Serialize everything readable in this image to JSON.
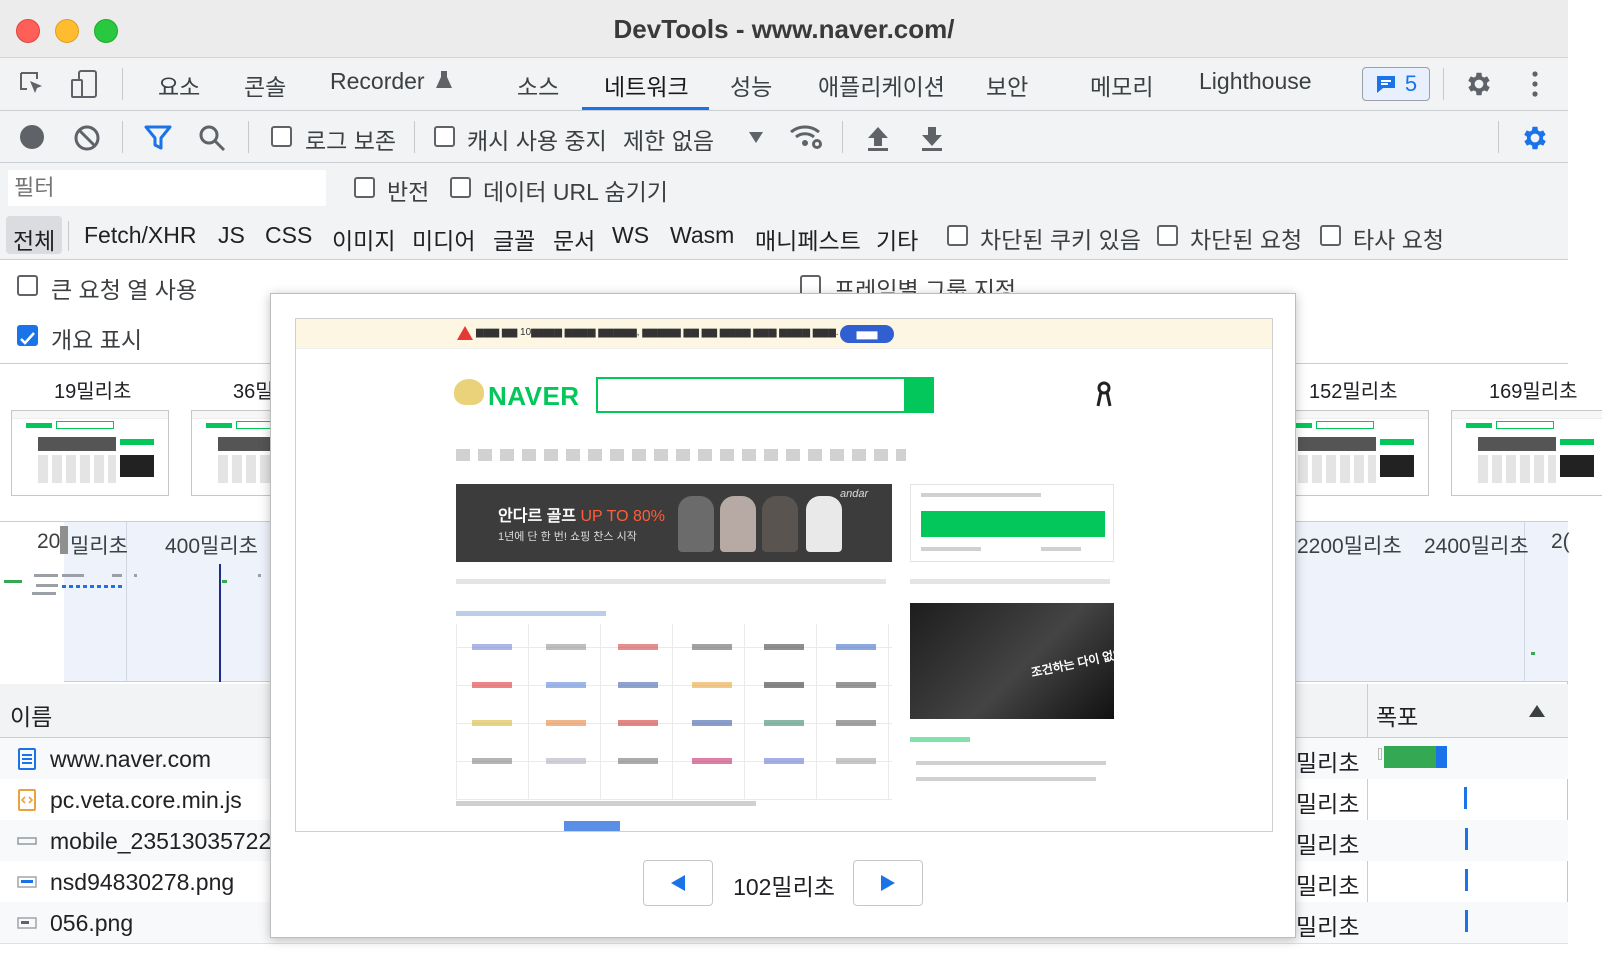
{
  "window": {
    "title": "DevTools - www.naver.com/"
  },
  "tabs": [
    {
      "label": "요소"
    },
    {
      "label": "콘솔"
    },
    {
      "label": "Recorder"
    },
    {
      "label": "소스"
    },
    {
      "label": "네트워크",
      "active": true
    },
    {
      "label": "성능"
    },
    {
      "label": "애플리케이션"
    },
    {
      "label": "보안"
    },
    {
      "label": "메모리"
    },
    {
      "label": "Lighthouse"
    }
  ],
  "issues_count": "5",
  "toolbar": {
    "preserve_log": "로그 보존",
    "disable_cache": "캐시 사용 중지",
    "throttle": "제한 없음"
  },
  "filter": {
    "placeholder": "필터",
    "invert": "반전",
    "hide_data_urls": "데이터 URL 숨기기"
  },
  "types": [
    "전체",
    "Fetch/XHR",
    "JS",
    "CSS",
    "이미지",
    "미디어",
    "글꼴",
    "문서",
    "WS",
    "Wasm",
    "매니페스트",
    "기타"
  ],
  "type_filters": {
    "blocked_cookies": "차단된 쿠키 있음",
    "blocked_requests": "차단된 요청",
    "third_party": "타사 요청"
  },
  "settings": {
    "big_rows": "큰 요청 열 사용",
    "group_by_frame": "프레임별 그룹 지정",
    "show_overview": "개요 표시"
  },
  "filmstrip": [
    {
      "label": "19밀리초"
    },
    {
      "label": "36밀"
    },
    {
      "label": "152밀리초"
    },
    {
      "label": "169밀리초"
    }
  ],
  "overview_ticks": [
    "20",
    "밀리초",
    "400밀리초",
    "2200밀리초",
    "2400밀리초",
    "2("
  ],
  "table": {
    "name_header": "이름",
    "waterfall_header": "폭포",
    "rows": [
      {
        "name": "www.naver.com",
        "time": "밀리초",
        "icon": "document-icon"
      },
      {
        "name": "pc.veta.core.min.js",
        "time": "밀리초",
        "icon": "script-icon"
      },
      {
        "name": "mobile_23513035722",
        "time": "밀리초",
        "icon": "file-icon"
      },
      {
        "name": "nsd94830278.png",
        "time": "밀리초",
        "icon": "image-icon"
      },
      {
        "name": "056.png",
        "time": "밀리초",
        "icon": "image-icon"
      }
    ]
  },
  "popup": {
    "frame_time": "102밀리초",
    "banner_title": "안다르 골프",
    "banner_accent": "UP TO 80%",
    "banner_sub": "1년에 단 한 번! 쇼핑 찬스 시작",
    "logo": "NAVER",
    "photo_caption": "조건하는 다이 없었다",
    "andar": "andar"
  },
  "colors": {
    "accent": "#1a73e8",
    "naver_green": "#03c75a",
    "close": "#fe5f57",
    "minimize": "#febc2e",
    "zoom": "#28c840"
  }
}
